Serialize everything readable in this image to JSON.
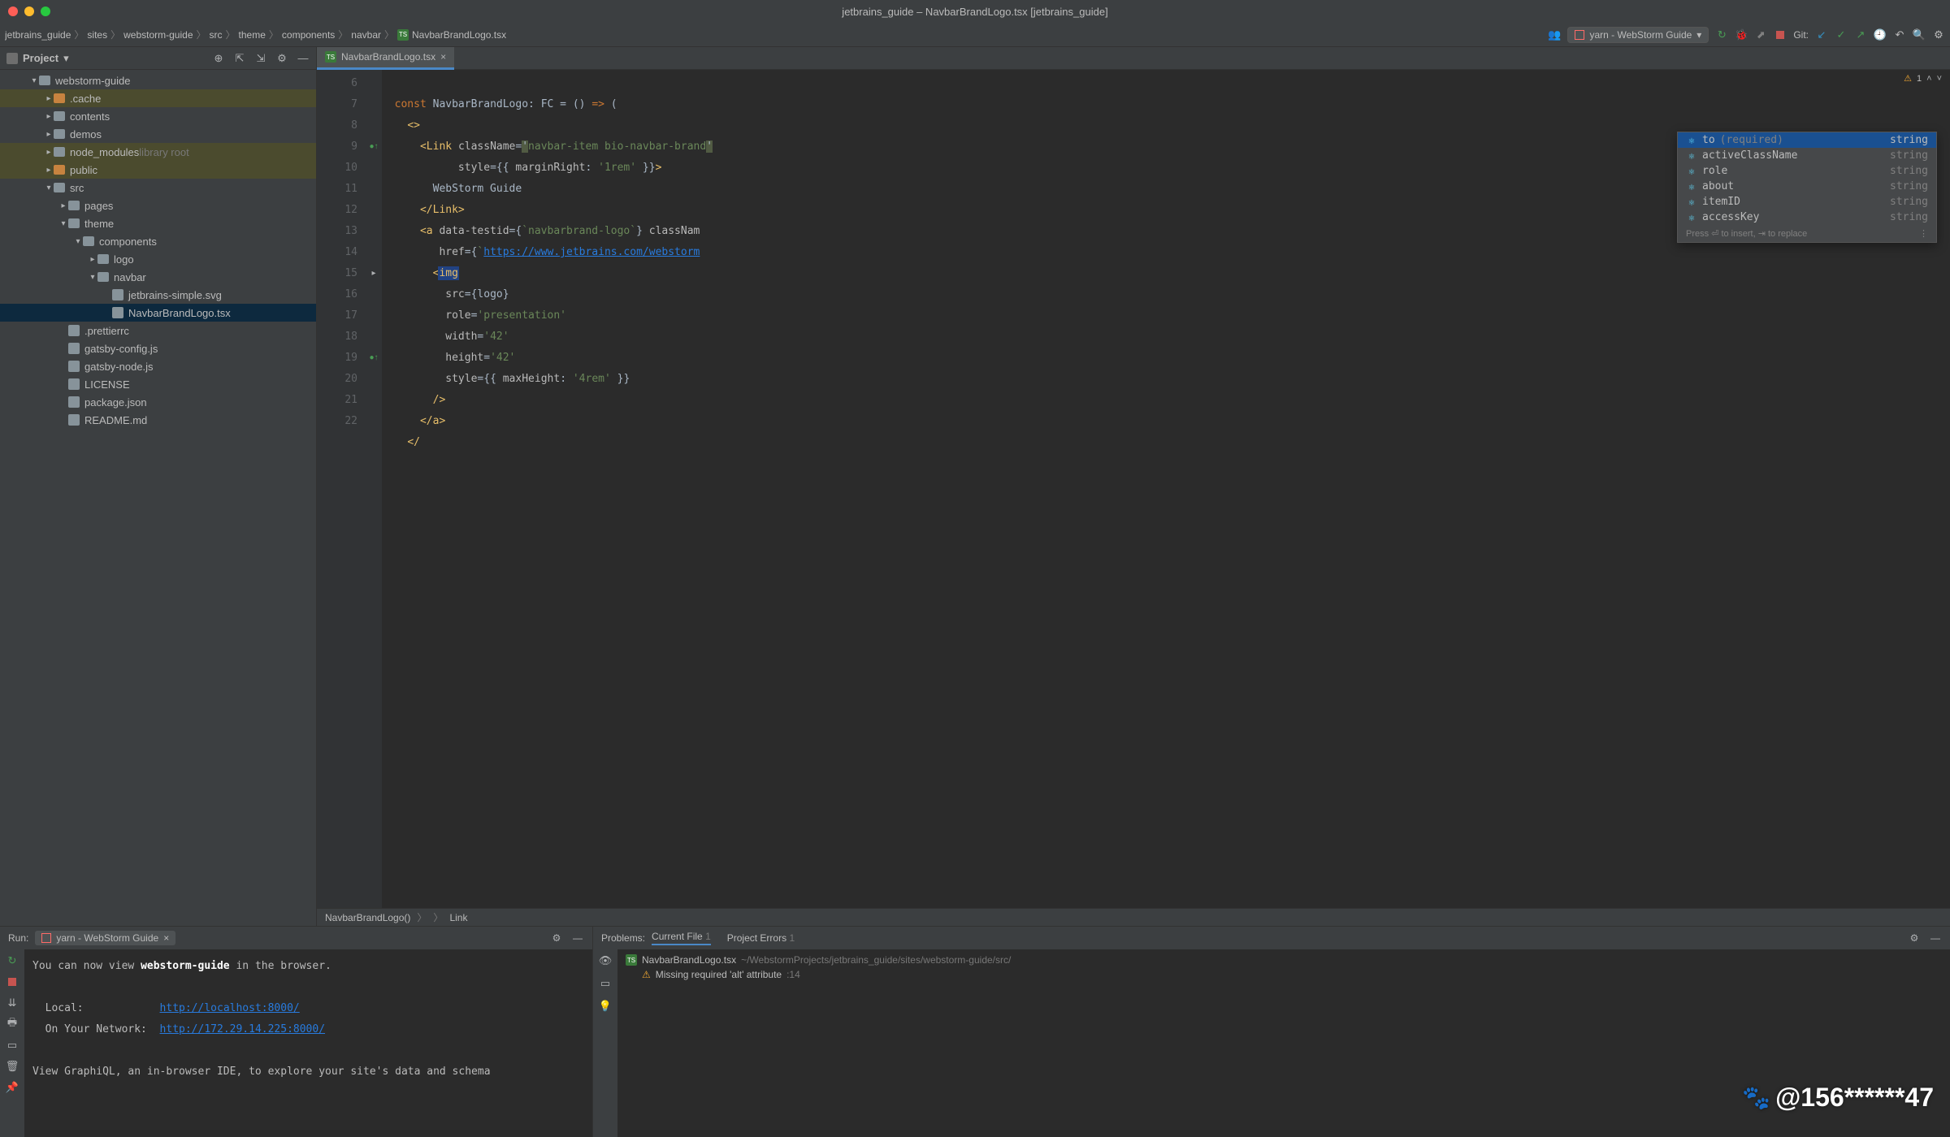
{
  "window": {
    "title": "jetbrains_guide – NavbarBrandLogo.tsx [jetbrains_guide]"
  },
  "breadcrumb": [
    "jetbrains_guide",
    "sites",
    "webstorm-guide",
    "src",
    "theme",
    "components",
    "navbar",
    "NavbarBrandLogo.tsx"
  ],
  "run_config": "yarn - WebStorm Guide",
  "git_label": "Git:",
  "sidebar": {
    "title": "Project",
    "tree": [
      {
        "indent": 2,
        "type": "folder",
        "label": "webstorm-guide",
        "expanded": true
      },
      {
        "indent": 3,
        "type": "folder-orange",
        "label": ".cache",
        "hl": true
      },
      {
        "indent": 3,
        "type": "folder",
        "label": "contents"
      },
      {
        "indent": 3,
        "type": "folder",
        "label": "demos"
      },
      {
        "indent": 3,
        "type": "folder",
        "label": "node_modules",
        "suffix": "library root",
        "hl": true
      },
      {
        "indent": 3,
        "type": "folder-orange",
        "label": "public",
        "hl": true
      },
      {
        "indent": 3,
        "type": "folder",
        "label": "src",
        "expanded": true
      },
      {
        "indent": 4,
        "type": "folder",
        "label": "pages"
      },
      {
        "indent": 4,
        "type": "folder",
        "label": "theme",
        "expanded": true
      },
      {
        "indent": 5,
        "type": "folder",
        "label": "components",
        "expanded": true
      },
      {
        "indent": 6,
        "type": "folder",
        "label": "logo"
      },
      {
        "indent": 6,
        "type": "folder",
        "label": "navbar",
        "expanded": true
      },
      {
        "indent": 7,
        "type": "file",
        "label": "jetbrains-simple.svg"
      },
      {
        "indent": 7,
        "type": "file-tsx",
        "label": "NavbarBrandLogo.tsx",
        "selected": true
      },
      {
        "indent": 4,
        "type": "file",
        "label": ".prettierrc"
      },
      {
        "indent": 4,
        "type": "file-js",
        "label": "gatsby-config.js"
      },
      {
        "indent": 4,
        "type": "file-js",
        "label": "gatsby-node.js"
      },
      {
        "indent": 4,
        "type": "file",
        "label": "LICENSE"
      },
      {
        "indent": 4,
        "type": "file",
        "label": "package.json"
      },
      {
        "indent": 4,
        "type": "file-md",
        "label": "README.md"
      }
    ]
  },
  "editor": {
    "tab": "NavbarBrandLogo.tsx",
    "lines_start": 6,
    "lines_end": 22,
    "warning_count": "1",
    "breadcrumbs": [
      "NavbarBrandLogo()",
      "Link"
    ]
  },
  "code": {
    "l6": "const NavbarBrandLogo: FC = () => (",
    "l7_frag": "<>",
    "l8_tag": "Link",
    "l8_attr": "className",
    "l8_val": "'navbar-item bio-navbar-brand'",
    "l9_attr": "style",
    "l9_key": "marginRight",
    "l9_val": "'1rem'",
    "l10": "WebStorm Guide",
    "l11": "</Link>",
    "l12_attr1": "data-testid",
    "l12_val1": "`navbarbrand-logo`",
    "l12_attr2": "className",
    "l13_attr": "href",
    "l13_val": "https://www.jetbrains.com/webstorm",
    "l14_tag": "img",
    "l15_attr": "src",
    "l15_val": "{logo}",
    "l16_attr": "role",
    "l16_val": "'presentation'",
    "l17_attr": "width",
    "l17_val": "'42'",
    "l18_attr": "height",
    "l18_val": "'42'",
    "l19_attr": "style",
    "l19_key": "maxHeight",
    "l19_val": "'4rem'"
  },
  "completion": {
    "items": [
      {
        "name": "to",
        "req": "(required)",
        "type": "string",
        "sel": true
      },
      {
        "name": "activeClassName",
        "type": "string"
      },
      {
        "name": "role",
        "type": "string"
      },
      {
        "name": "about",
        "type": "string"
      },
      {
        "name": "itemID",
        "type": "string"
      },
      {
        "name": "accessKey",
        "type": "string"
      }
    ],
    "hint": "Press ⏎ to insert, ⇥ to replace"
  },
  "run": {
    "label": "Run:",
    "tab": "yarn - WebStorm Guide",
    "line1_pre": "You can now view ",
    "line1_bold": "webstorm-guide",
    "line1_post": " in the browser.",
    "local_label": "Local:",
    "local_url": "http://localhost:8000/",
    "net_label": "On Your Network:",
    "net_url": "http://172.29.14.225:8000/",
    "graphiql": "View GraphiQL, an in-browser IDE, to explore your site's data and schema"
  },
  "problems": {
    "label": "Problems:",
    "tab_current": "Current File",
    "tab_current_count": "1",
    "tab_errors": "Project Errors",
    "tab_errors_count": "1",
    "file": "NavbarBrandLogo.tsx",
    "path": "~/WebstormProjects/jetbrains_guide/sites/webstorm-guide/src/",
    "issue": "Missing required 'alt' attribute",
    "issue_line": ":14"
  },
  "watermark": "@156******47"
}
